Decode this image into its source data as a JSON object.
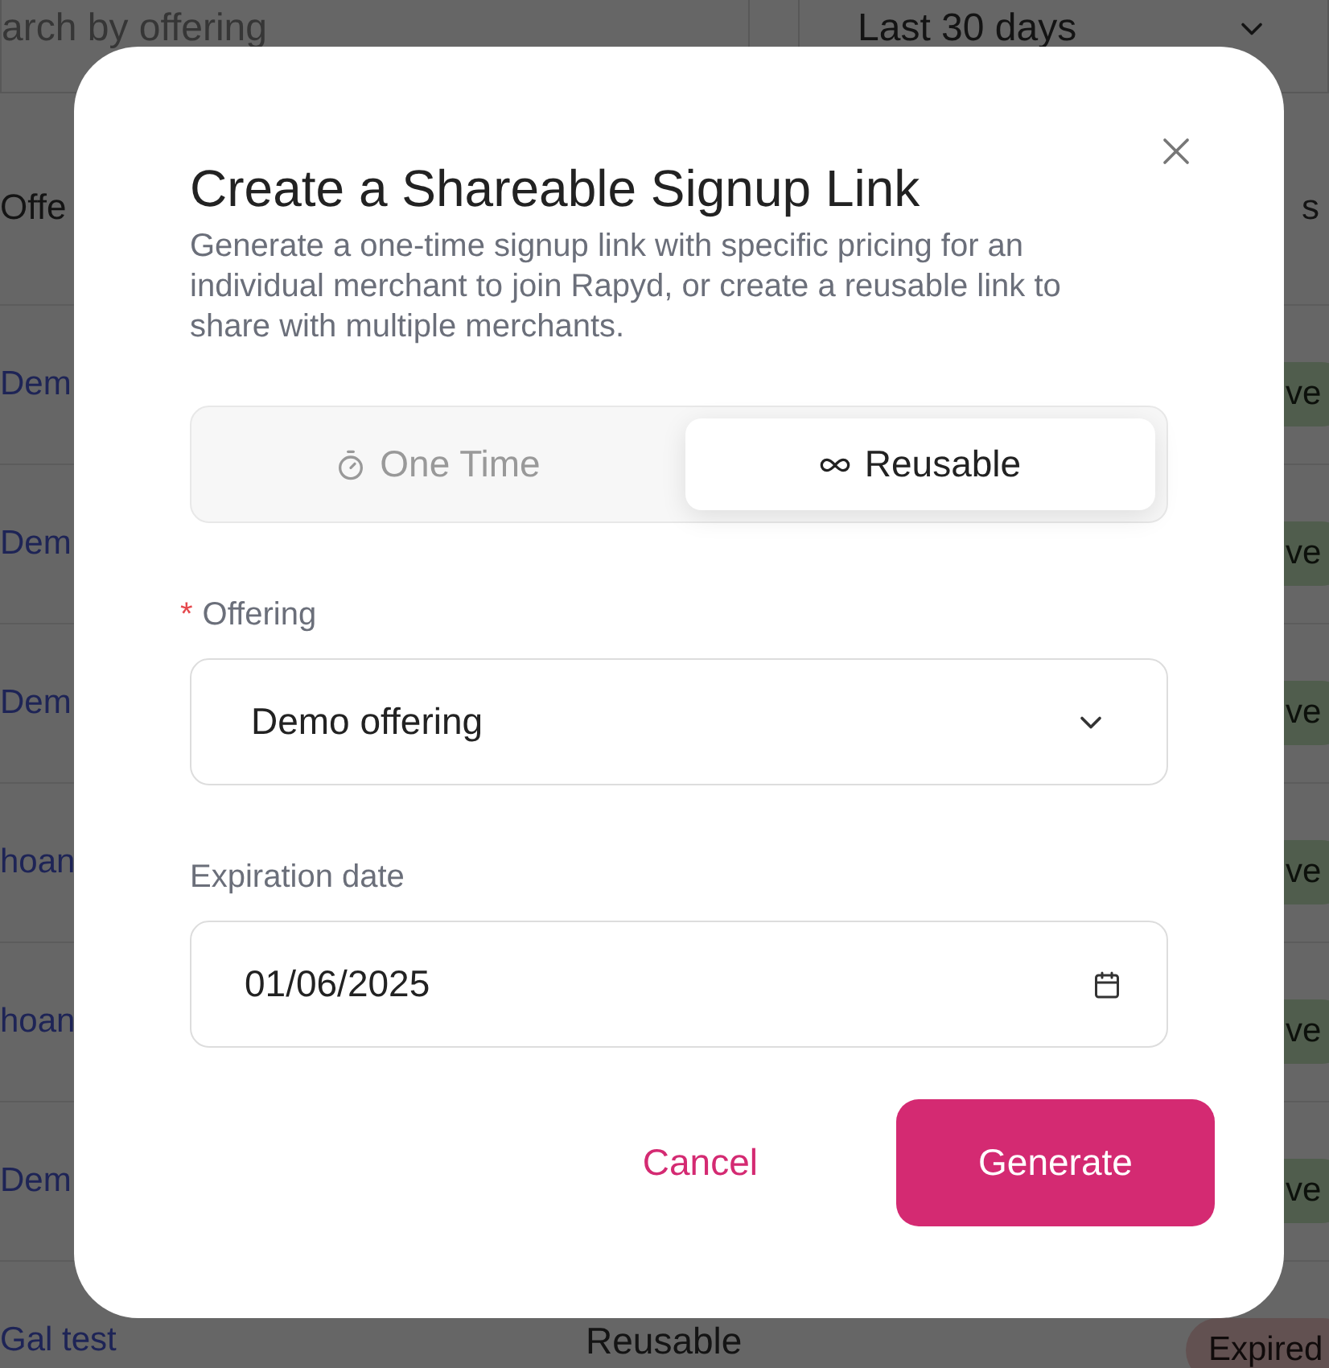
{
  "background": {
    "search": {
      "placeholder": "arch by offering"
    },
    "date_range": {
      "value": "Last 30 days"
    },
    "table": {
      "columns": [
        "Offe",
        "s"
      ],
      "rows": [
        {
          "offering": "Dem",
          "status": "ve",
          "kind": "active"
        },
        {
          "offering": "Dem",
          "status": "ve",
          "kind": "active"
        },
        {
          "offering": "Dem",
          "status": "ve",
          "kind": "active"
        },
        {
          "offering": "hoan",
          "status": "ve",
          "kind": "active"
        },
        {
          "offering": "hoan",
          "status": "ve",
          "kind": "active"
        },
        {
          "offering": "Dem",
          "status": "ve",
          "kind": "active"
        },
        {
          "offering": "Gal test",
          "type": "Reusable",
          "status": "Expired",
          "kind": "expired"
        }
      ]
    }
  },
  "dialog": {
    "title": "Create a Shareable Signup Link",
    "description": "Generate a one-time signup link with specific pricing for an individual merchant to join Rapyd, or create a reusable link to share with multiple merchants.",
    "tabs": [
      {
        "label": "One Time",
        "kind": "stopwatch",
        "selected": false
      },
      {
        "label": "Reusable",
        "kind": "infinity",
        "selected": true
      }
    ],
    "offering": {
      "label": "Offering",
      "required_mark": "*",
      "value": "Demo offering"
    },
    "expiration": {
      "label": "Expiration date",
      "value": "01/06/2025"
    },
    "buttons": {
      "cancel": "Cancel",
      "generate": "Generate"
    }
  }
}
